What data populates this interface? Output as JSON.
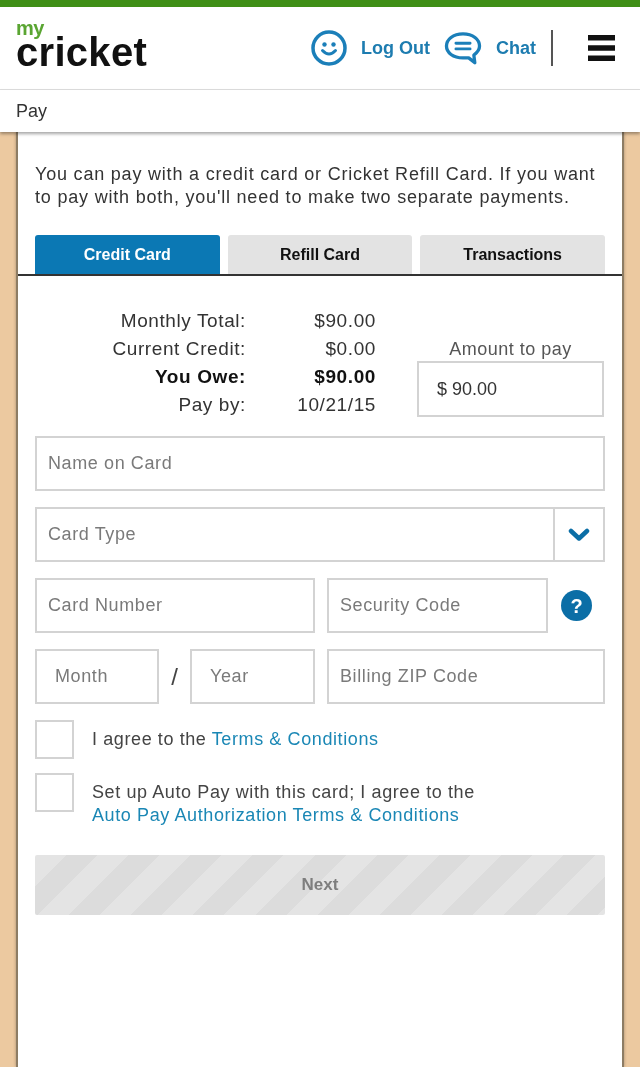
{
  "header": {
    "logo": {
      "small": "my",
      "wordmark": "cricket"
    },
    "actions": [
      {
        "kind": "account",
        "label": "Log Out"
      },
      {
        "kind": "chat",
        "label": "Chat"
      }
    ]
  },
  "breadcrumb": "Pay",
  "intro": "You can pay with a credit card or Cricket Refill Card. If you want to pay with both, you'll need to make two separate payments.",
  "tabs": [
    {
      "label": "Credit Card",
      "selected": true
    },
    {
      "label": "Refill Card",
      "selected": false
    },
    {
      "label": "Transactions",
      "selected": false
    }
  ],
  "summary": {
    "rows": [
      {
        "label": "Monthly Total:",
        "value": "$90.00",
        "bold": false
      },
      {
        "label": "Current Credit:",
        "value": "$0.00",
        "bold": false
      },
      {
        "label": "You Owe:",
        "value": "$90.00",
        "bold": true
      },
      {
        "label": "Pay by:",
        "value": "10/21/15",
        "bold": false
      }
    ],
    "amount": {
      "label": "Amount to pay",
      "value": "$ 90.00"
    }
  },
  "form": {
    "name_on_card": {
      "placeholder": "Name on Card"
    },
    "card_type": {
      "placeholder": "Card Type"
    },
    "card_number": {
      "placeholder": "Card Number"
    },
    "security_code": {
      "placeholder": "Security Code",
      "help": "?"
    },
    "month": {
      "placeholder": "Month"
    },
    "date_separator": "/",
    "year": {
      "placeholder": "Year"
    },
    "billing_zip": {
      "placeholder": "Billing ZIP Code"
    }
  },
  "checkboxes": [
    {
      "text": "I agree to the",
      "link": "Terms & Conditions",
      "checked": false
    },
    {
      "text": "Set up Auto Pay with this card; I agree to the",
      "link": "Auto Pay Authorization Terms & Conditions",
      "checked": false
    }
  ],
  "next_button": {
    "label": "Next",
    "disabled": true
  }
}
